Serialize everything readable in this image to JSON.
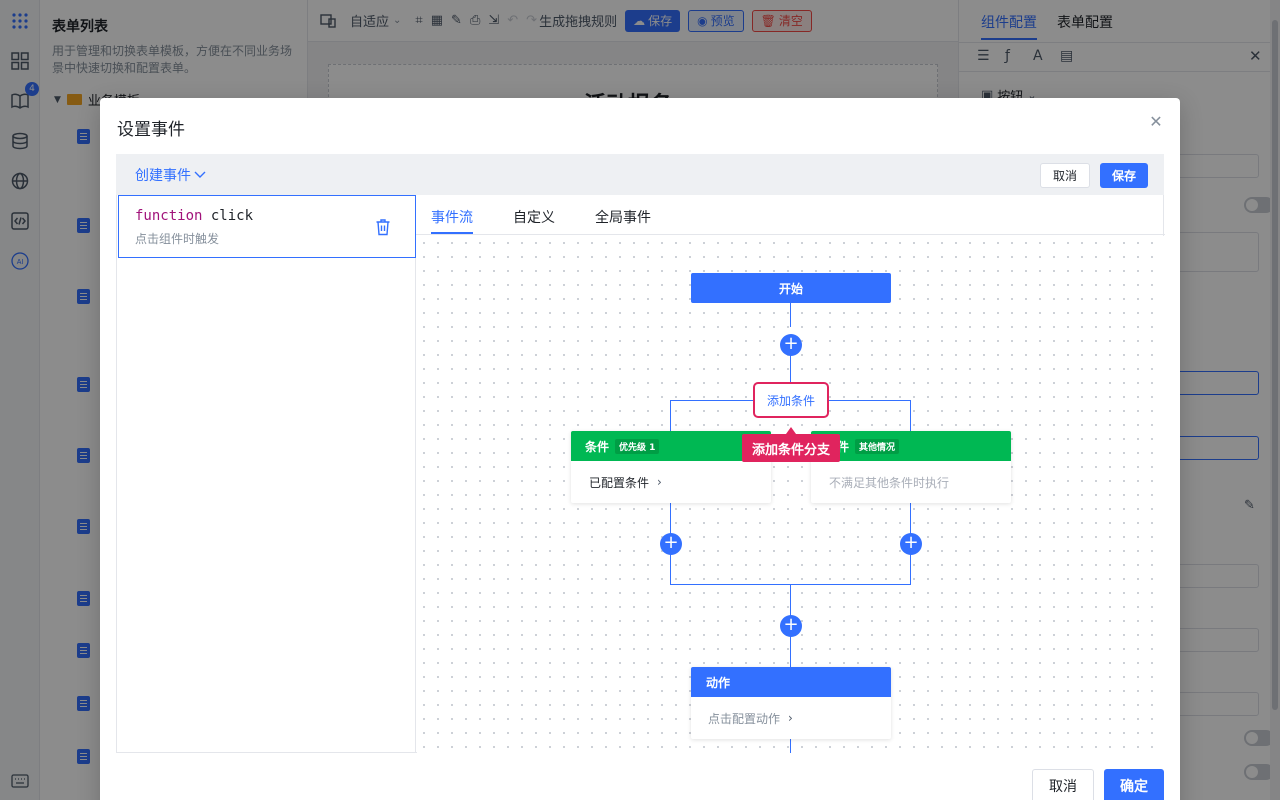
{
  "app": {
    "rail_badge": "4",
    "rail_ai": "AI",
    "tree": {
      "title": "表单列表",
      "desc": "用于管理和切换表单模板，方便在不同业务场景中快速切换和配置表单。",
      "group": "业务模板"
    },
    "toolbar": {
      "adaptive": "自适应",
      "generate_rule": "生成拖拽规则",
      "save": "保存",
      "preview": "预览",
      "clear": "清空"
    },
    "canvas_title": "活动报名",
    "right_panel": {
      "tab_component": "组件配置",
      "tab_form": "表单配置",
      "component_type": "按钮"
    }
  },
  "dialog": {
    "title": "设置事件",
    "create_event": "创建事件",
    "header_cancel": "取消",
    "header_save": "保存",
    "event": {
      "keyword": "function",
      "name": "click",
      "desc": "点击组件时触发"
    },
    "tabs": [
      "事件流",
      "自定义",
      "全局事件"
    ],
    "flow": {
      "start": "开始",
      "add_condition": "添加条件",
      "tooltip": "添加条件分支",
      "cond1_title": "条件",
      "cond1_badge": "优先级 1",
      "cond1_body": "已配置条件",
      "cond2_title": "条件",
      "cond2_badge": "其他情况",
      "cond2_body": "不满足其他条件时执行",
      "action_title": "动作",
      "action_body": "点击配置动作"
    },
    "footer_cancel": "取消",
    "footer_ok": "确定"
  },
  "colors": {
    "primary": "#3370ff",
    "condition": "#00b853",
    "highlight": "#e0245e",
    "clear_btn": "#f54a45"
  }
}
